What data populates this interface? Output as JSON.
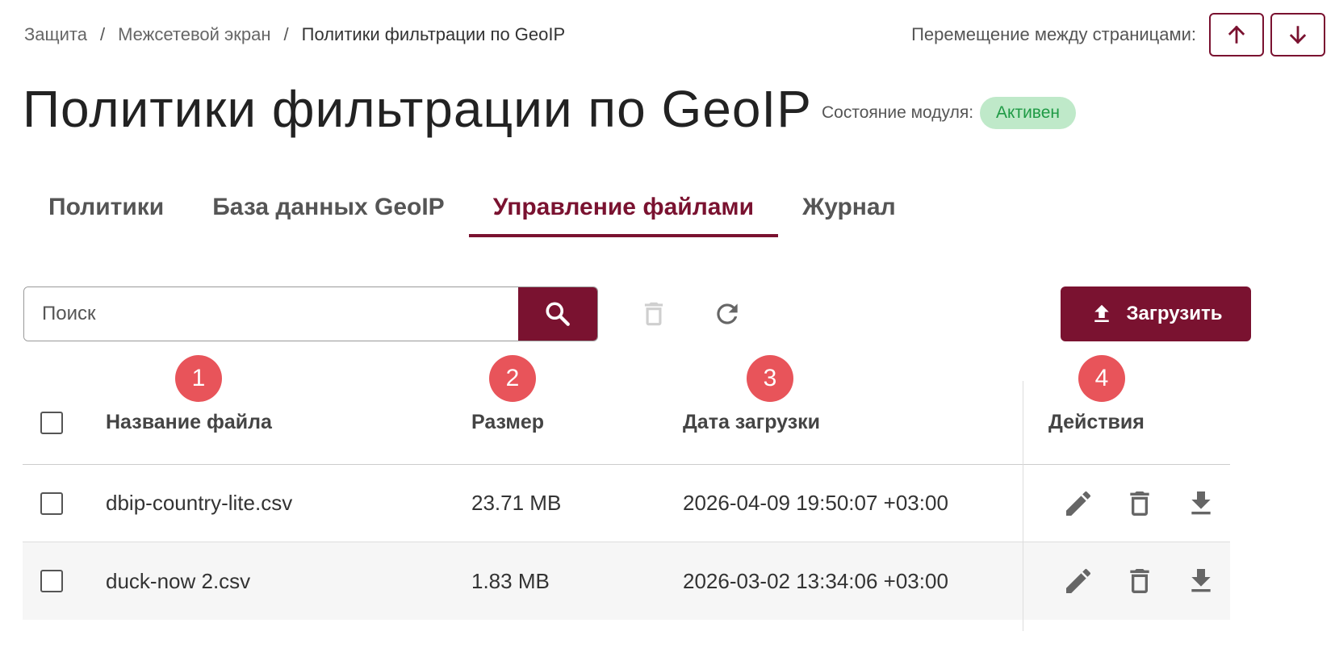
{
  "breadcrumb": {
    "items": [
      "Защита",
      "Межсетевой экран"
    ],
    "current": "Политики фильтрации по GeoIP",
    "separator": "/"
  },
  "page_nav": {
    "label": "Перемещение между страницами:"
  },
  "page_title": "Политики фильтрации по GeoIP",
  "module_state": {
    "label": "Состояние модуля:",
    "value": "Активен"
  },
  "tabs": [
    {
      "label": "Политики"
    },
    {
      "label": "База данных GeoIP"
    },
    {
      "label": "Управление файлами"
    },
    {
      "label": "Журнал"
    }
  ],
  "toolbar": {
    "search_placeholder": "Поиск",
    "upload_label": "Загрузить"
  },
  "markers": [
    "1",
    "2",
    "3",
    "4"
  ],
  "table": {
    "headers": {
      "name": "Название файла",
      "size": "Размер",
      "date": "Дата загрузки",
      "actions": "Действия"
    },
    "rows": [
      {
        "name": "dbip-country-lite.csv",
        "size": "23.71 MB",
        "date": "2026-04-09 19:50:07 +03:00"
      },
      {
        "name": "duck-now 2.csv",
        "size": "1.83 MB",
        "date": "2026-03-02 13:34:06 +03:00"
      }
    ]
  },
  "colors": {
    "accent": "#7a1230",
    "status_bg": "#bfe9c9",
    "status_text": "#1f9a45",
    "marker": "#e8545a"
  }
}
